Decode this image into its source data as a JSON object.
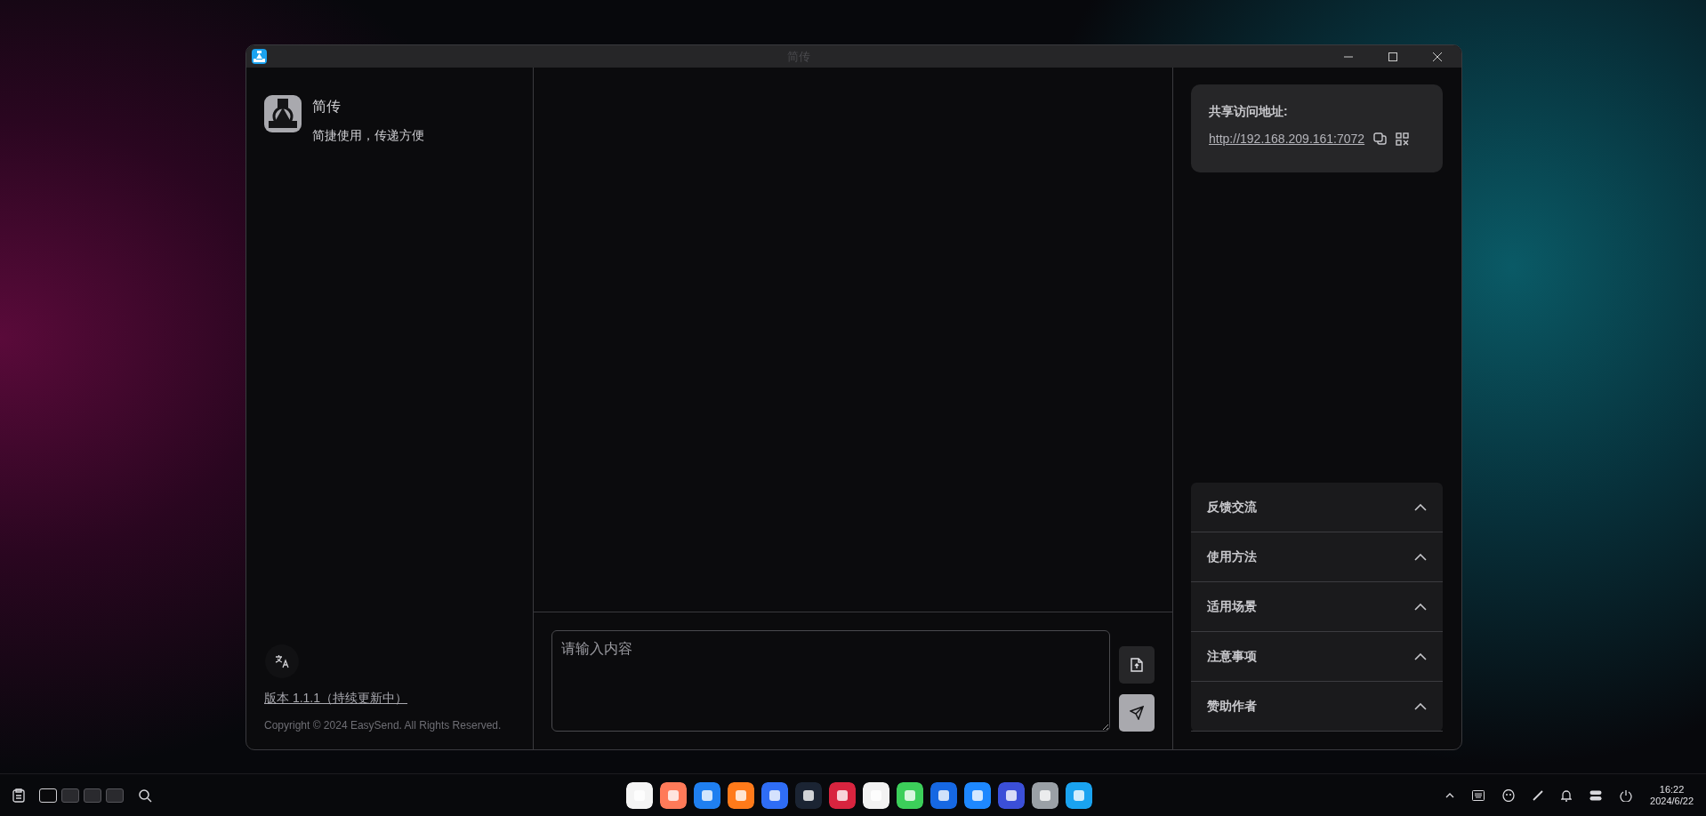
{
  "window": {
    "title": "简传"
  },
  "sidebar": {
    "app_name": "简传",
    "tagline": "简捷使用，传递方便",
    "version_link": "版本 1.1.1（持续更新中）",
    "copyright": "Copyright © 2024 EasySend. All Rights Reserved."
  },
  "composer": {
    "placeholder": "请输入内容"
  },
  "share_card": {
    "label": "共享访问地址:",
    "url": "http://192.168.209.161:7072"
  },
  "accordion": [
    {
      "title": "反馈交流"
    },
    {
      "title": "使用方法"
    },
    {
      "title": "适用场景"
    },
    {
      "title": "注意事项"
    },
    {
      "title": "赞助作者"
    }
  ],
  "taskbar": {
    "workspaces": [
      {
        "selected": true
      },
      {
        "selected": false
      },
      {
        "selected": false
      },
      {
        "selected": false
      }
    ],
    "time": "16:22",
    "date": "2024/6/22"
  }
}
